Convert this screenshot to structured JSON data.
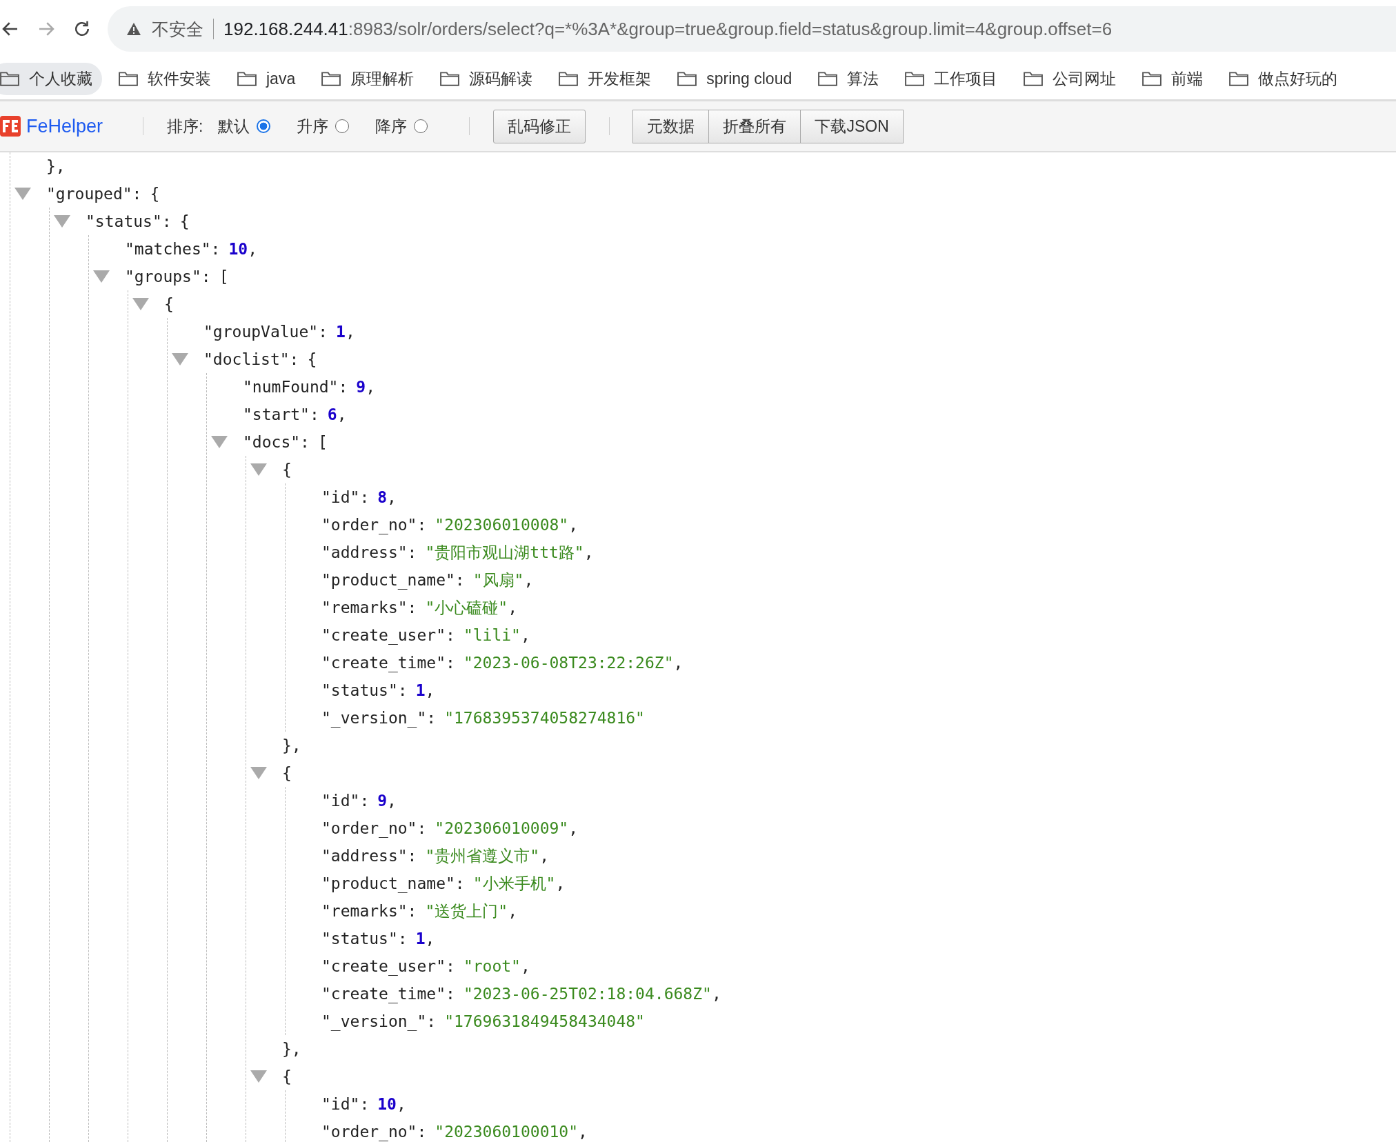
{
  "address_bar": {
    "security_label": "不安全",
    "url_host": "192.168.244.41",
    "url_rest": ":8983/solr/orders/select?q=*%3A*&group=true&group.field=status&group.limit=4&group.offset=6"
  },
  "bookmarks": [
    {
      "label": "个人收藏",
      "selected": true
    },
    {
      "label": "软件安装",
      "selected": false
    },
    {
      "label": "java",
      "selected": false
    },
    {
      "label": "原理解析",
      "selected": false
    },
    {
      "label": "源码解读",
      "selected": false
    },
    {
      "label": "开发框架",
      "selected": false
    },
    {
      "label": "spring cloud",
      "selected": false
    },
    {
      "label": "算法",
      "selected": false
    },
    {
      "label": "工作项目",
      "selected": false
    },
    {
      "label": "公司网址",
      "selected": false
    },
    {
      "label": "前端",
      "selected": false
    },
    {
      "label": "做点好玩的",
      "selected": false
    }
  ],
  "toolbar": {
    "logo_text": "FeHelper",
    "sort_label": "排序:",
    "sort_options": [
      {
        "label": "默认",
        "selected": true
      },
      {
        "label": "升序",
        "selected": false
      },
      {
        "label": "降序",
        "selected": false
      }
    ],
    "fix_button": "乱码修正",
    "buttons": [
      "元数据",
      "折叠所有",
      "下载JSON"
    ]
  },
  "tree": [
    {
      "kind": "close",
      "text": "},"
    },
    {
      "kind": "object",
      "key": "\"grouped\":",
      "open": "{",
      "expanded": true,
      "children": [
        {
          "kind": "object",
          "key": "\"status\":",
          "open": "{",
          "expanded": true,
          "children": [
            {
              "kind": "number",
              "key": "\"matches\":",
              "value": "10",
              "comma": ","
            },
            {
              "kind": "object",
              "key": "\"groups\":",
              "open": "[",
              "expanded": true,
              "children": [
                {
                  "kind": "object",
                  "open": "{",
                  "expanded": true,
                  "children": [
                    {
                      "kind": "number",
                      "key": "\"groupValue\":",
                      "value": "1",
                      "comma": ","
                    },
                    {
                      "kind": "object",
                      "key": "\"doclist\":",
                      "open": "{",
                      "expanded": true,
                      "children": [
                        {
                          "kind": "number",
                          "key": "\"numFound\":",
                          "value": "9",
                          "comma": ","
                        },
                        {
                          "kind": "number",
                          "key": "\"start\":",
                          "value": "6",
                          "comma": ","
                        },
                        {
                          "kind": "object",
                          "key": "\"docs\":",
                          "open": "[",
                          "expanded": true,
                          "children": [
                            {
                              "kind": "object",
                              "open": "{",
                              "expanded": true,
                              "close": "},",
                              "children": [
                                {
                                  "kind": "number",
                                  "key": "\"id\":",
                                  "value": "8",
                                  "comma": ","
                                },
                                {
                                  "kind": "string",
                                  "key": "\"order_no\":",
                                  "value": "\"202306010008\"",
                                  "comma": ","
                                },
                                {
                                  "kind": "string",
                                  "key": "\"address\":",
                                  "value": "\"贵阳市观山湖ttt路\"",
                                  "comma": ","
                                },
                                {
                                  "kind": "string",
                                  "key": "\"product_name\":",
                                  "value": "\"风扇\"",
                                  "comma": ","
                                },
                                {
                                  "kind": "string",
                                  "key": "\"remarks\":",
                                  "value": "\"小心磕碰\"",
                                  "comma": ","
                                },
                                {
                                  "kind": "string",
                                  "key": "\"create_user\":",
                                  "value": "\"lili\"",
                                  "comma": ","
                                },
                                {
                                  "kind": "string",
                                  "key": "\"create_time\":",
                                  "value": "\"2023-06-08T23:22:26Z\"",
                                  "comma": ","
                                },
                                {
                                  "kind": "number",
                                  "key": "\"status\":",
                                  "value": "1",
                                  "comma": ","
                                },
                                {
                                  "kind": "string",
                                  "key": "\"_version_\":",
                                  "value": "\"1768395374058274816\""
                                }
                              ]
                            },
                            {
                              "kind": "object",
                              "open": "{",
                              "expanded": true,
                              "close": "},",
                              "children": [
                                {
                                  "kind": "number",
                                  "key": "\"id\":",
                                  "value": "9",
                                  "comma": ","
                                },
                                {
                                  "kind": "string",
                                  "key": "\"order_no\":",
                                  "value": "\"202306010009\"",
                                  "comma": ","
                                },
                                {
                                  "kind": "string",
                                  "key": "\"address\":",
                                  "value": "\"贵州省遵义市\"",
                                  "comma": ","
                                },
                                {
                                  "kind": "string",
                                  "key": "\"product_name\":",
                                  "value": "\"小米手机\"",
                                  "comma": ","
                                },
                                {
                                  "kind": "string",
                                  "key": "\"remarks\":",
                                  "value": "\"送货上门\"",
                                  "comma": ","
                                },
                                {
                                  "kind": "number",
                                  "key": "\"status\":",
                                  "value": "1",
                                  "comma": ","
                                },
                                {
                                  "kind": "string",
                                  "key": "\"create_user\":",
                                  "value": "\"root\"",
                                  "comma": ","
                                },
                                {
                                  "kind": "string",
                                  "key": "\"create_time\":",
                                  "value": "\"2023-06-25T02:18:04.668Z\"",
                                  "comma": ","
                                },
                                {
                                  "kind": "string",
                                  "key": "\"_version_\":",
                                  "value": "\"1769631849458434048\""
                                }
                              ]
                            },
                            {
                              "kind": "object",
                              "open": "{",
                              "expanded": true,
                              "children": [
                                {
                                  "kind": "number",
                                  "key": "\"id\":",
                                  "value": "10",
                                  "comma": ","
                                },
                                {
                                  "kind": "string",
                                  "key": "\"order_no\":",
                                  "value": "\"2023060100010\"",
                                  "comma": ","
                                }
                              ]
                            }
                          ]
                        }
                      ]
                    }
                  ]
                }
              ]
            }
          ]
        }
      ]
    }
  ]
}
